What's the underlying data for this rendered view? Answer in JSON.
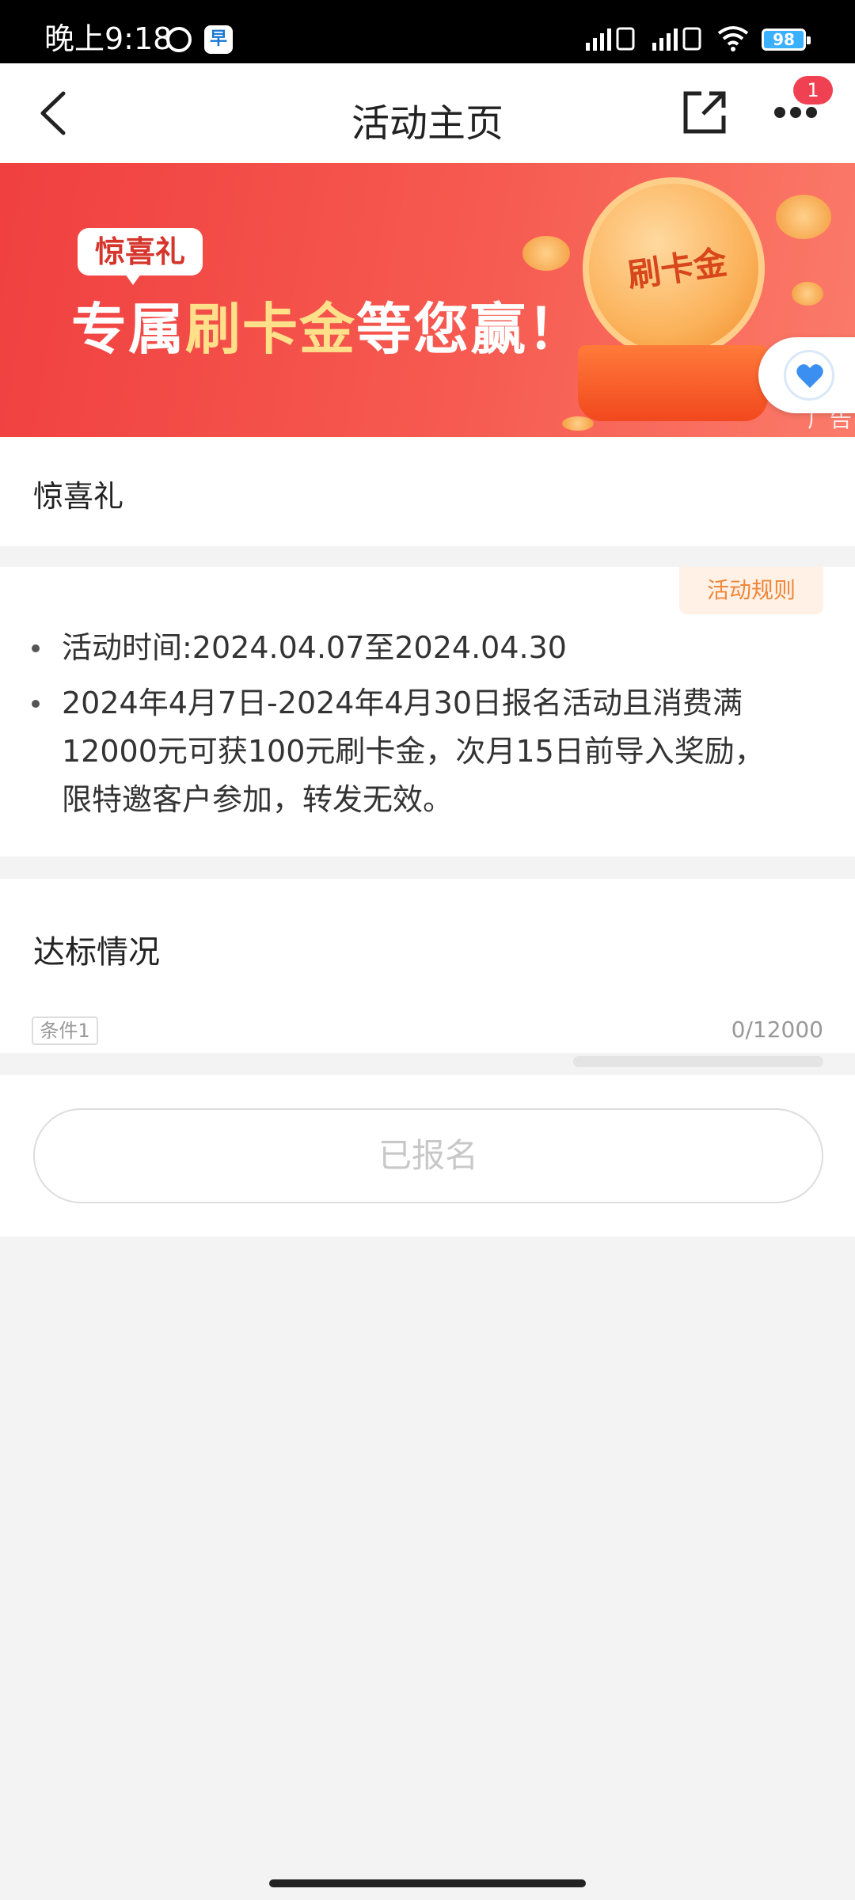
{
  "status_bar": {
    "time": "晚上9:18",
    "app_icon": "早",
    "battery": "98"
  },
  "nav": {
    "title": "活动主页",
    "badge_count": "1"
  },
  "banner": {
    "tag": "惊喜礼",
    "headline_part1": "专属",
    "headline_highlight": "刷卡金",
    "headline_part2": "等您赢！",
    "coin_text": "刷卡金",
    "ad_label": "广告"
  },
  "activity": {
    "name": "惊喜礼",
    "rules_button": "活动规则",
    "items": [
      {
        "lines": [
          "活动时间:2024.04.07至2024.04.30"
        ]
      },
      {
        "lines": [
          "2024年4月7日-2024年4月30日报名活动且消费满",
          "12000元可获100元刷卡金，次月15日前导入奖励，",
          "限特邀客户参加，转发无效。"
        ]
      }
    ]
  },
  "progress": {
    "title": "达标情况",
    "condition_label": "条件1",
    "count": "0/12000",
    "current": 0,
    "target": 12000
  },
  "action": {
    "button_label": "已报名"
  },
  "colors": {
    "accent_orange": "#f0873a",
    "badge_red": "#f04152",
    "banner_red": "#f04040",
    "heart_blue": "#3a8ff0"
  }
}
